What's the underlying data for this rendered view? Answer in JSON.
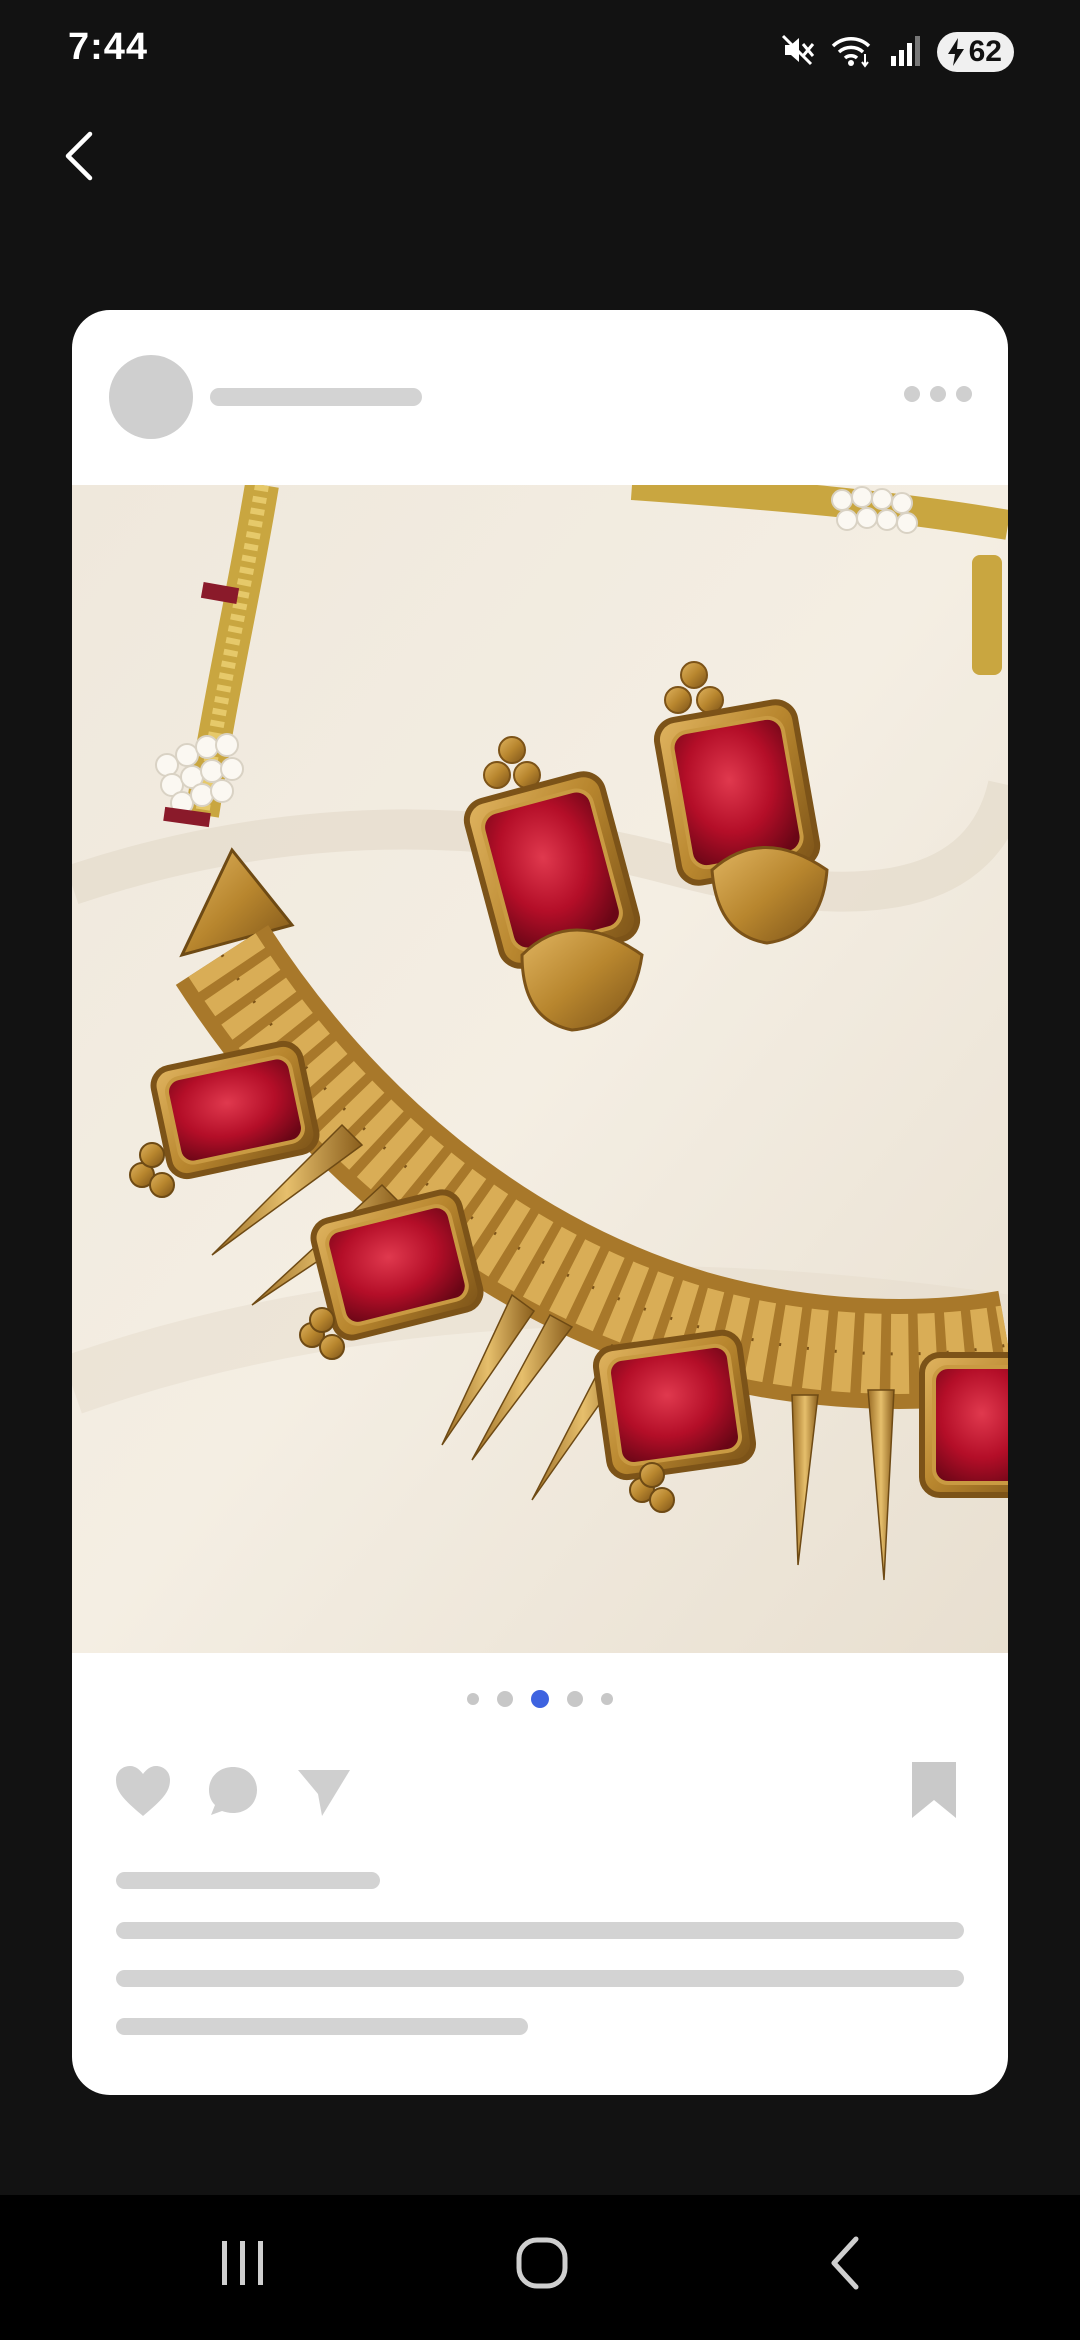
{
  "status_bar": {
    "time": "7:44",
    "battery_level": "62",
    "icons": [
      "mute-icon",
      "wifi-icon",
      "signal-icon",
      "battery-charging-icon"
    ]
  },
  "header": {
    "back_icon": "chevron-left-icon"
  },
  "post": {
    "image_description_icon": "jewelry-photo",
    "carousel": {
      "total": 5,
      "active_index": 3
    },
    "actions": [
      "heart-icon",
      "comment-icon",
      "share-icon",
      "bookmark-icon"
    ]
  },
  "colors": {
    "background": "#121212",
    "card": "#ffffff",
    "placeholder": "#d3d3d3",
    "accent_dot": "#3e63e0",
    "ruby": "#b0102a",
    "gold": "#b8862e"
  },
  "navigation": {
    "icons": [
      "recent-apps-icon",
      "home-icon",
      "back-icon"
    ]
  }
}
